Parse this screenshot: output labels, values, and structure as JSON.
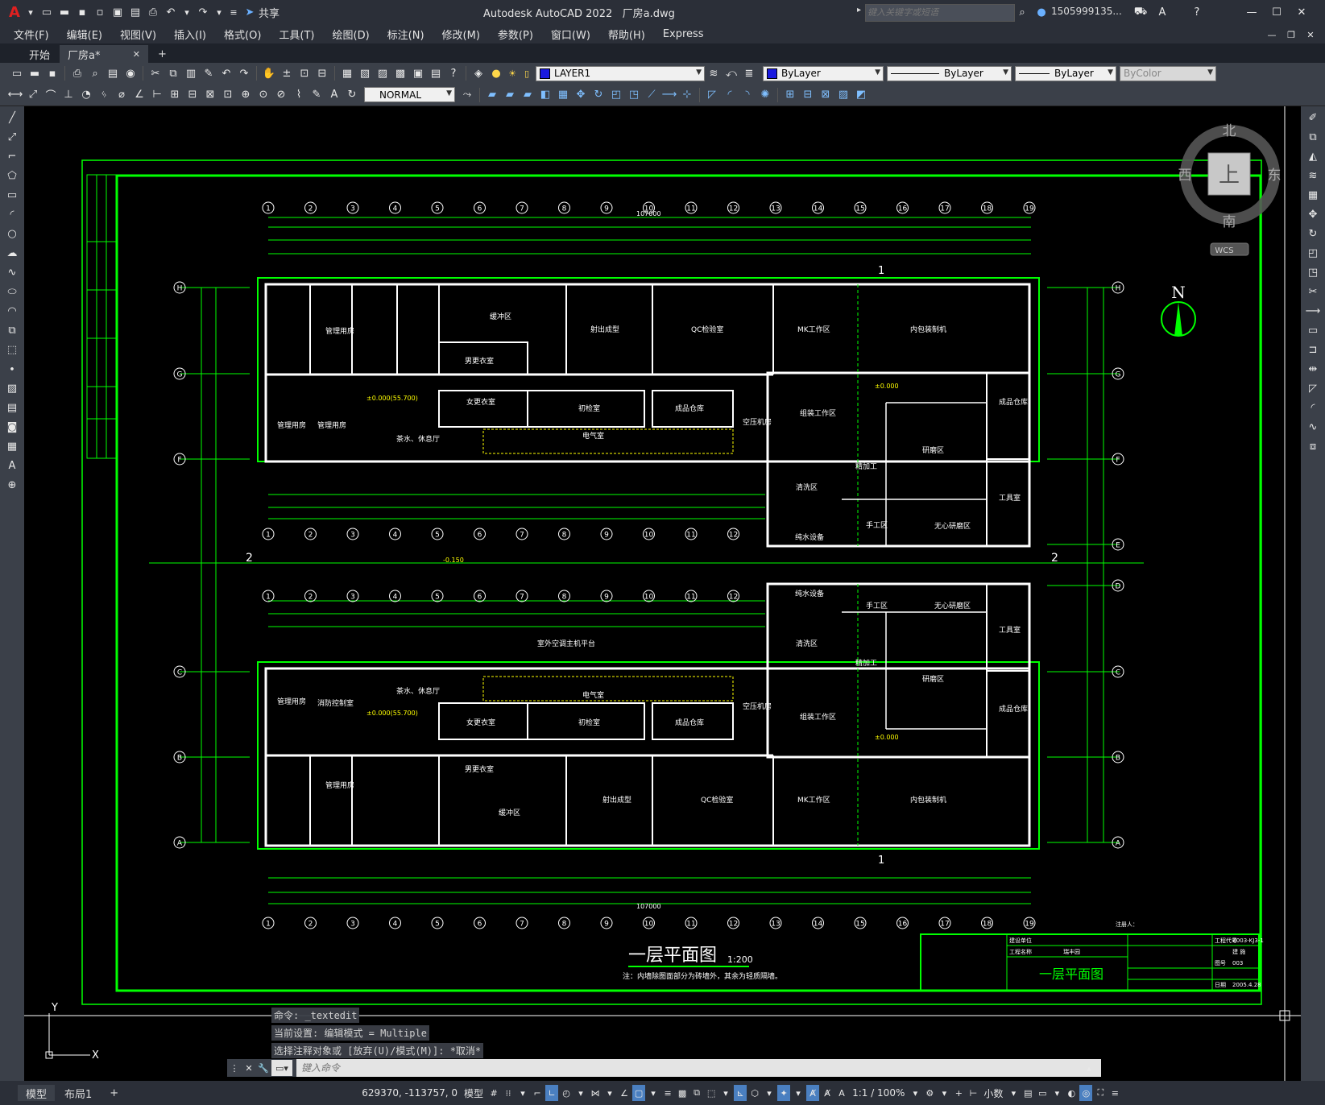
{
  "app": {
    "title": "Autodesk AutoCAD 2022",
    "filename": "厂房a.dwg",
    "share": "共享",
    "search_placeholder": "键入关键字或短语",
    "user": "1505999135..."
  },
  "menu": [
    "文件(F)",
    "编辑(E)",
    "视图(V)",
    "插入(I)",
    "格式(O)",
    "工具(T)",
    "绘图(D)",
    "标注(N)",
    "修改(M)",
    "参数(P)",
    "窗口(W)",
    "帮助(H)",
    "Express"
  ],
  "tabs": {
    "start": "开始",
    "doc": "厂房a*"
  },
  "toolbar": {
    "layer": "LAYER1",
    "color": "ByLayer",
    "linetype": "ByLayer",
    "lineweight": "ByLayer",
    "plotstyle": "ByColor",
    "dimstyle": "NORMAL"
  },
  "viewcube": {
    "north": "北",
    "south": "南",
    "west": "西",
    "east": "东",
    "top": "上",
    "wcs": "WCS"
  },
  "drawing": {
    "title": "一层平面图",
    "scale": "1:200",
    "note": "注：内墙除图面部分为砖墙外，其余为轻质隔墙。",
    "north": "N",
    "total_dim": "107000",
    "rooms_top": [
      "管理用房",
      "缓冲区",
      "射出成型",
      "QC检验室",
      "MK工作区",
      "内包装制机",
      "男更衣室",
      "女更衣室",
      "管理用房",
      "管理用房",
      "茶水、休息厅",
      "初检室",
      "成品仓库",
      "空压机房",
      "组装工作区",
      "电气室",
      "清洗区",
      "精加工",
      "研磨区",
      "纯水设备",
      "手工区",
      "无心研磨区",
      "成品仓库",
      "工具室"
    ],
    "rooms_bottom": [
      "纯水设备",
      "手工区",
      "无心研磨区",
      "工具室",
      "清洗区",
      "精加工",
      "研磨区",
      "管理用房",
      "消防控制室",
      "茶水、休息厅",
      "电气室",
      "女更衣室",
      "初检室",
      "成品仓库",
      "组装工作区",
      "成品仓库",
      "男更衣室",
      "管理用房",
      "缓冲区",
      "射出成型",
      "QC检验室",
      "MK工作区",
      "内包装制机",
      "空压机房",
      "室外空调主机平台"
    ],
    "levels": [
      "±0.000(55.700)",
      "±0.000",
      "-0.150",
      "±0.000"
    ],
    "tb_labels": [
      "建设单位",
      "工程名称",
      "工程代号",
      "图号",
      "日期"
    ],
    "tb_values": [
      "瑞丰园",
      "一层平面图",
      "Z003-KJ3-1",
      "建 施",
      "003",
      "2005.4.28"
    ],
    "signer": "注册人："
  },
  "command_history": [
    "命令: _textedit",
    "当前设置: 编辑模式 = Multiple",
    "选择注释对象或 [放弃(U)/模式(M)]: *取消*"
  ],
  "command_placeholder": "键入命令",
  "layout_tabs": {
    "model": "模型",
    "layout1": "布局1",
    "add": "+"
  },
  "status": {
    "coords": "629370, -113757, 0",
    "space": "模型",
    "scale": "1:1 / 100%",
    "units": "小数"
  }
}
